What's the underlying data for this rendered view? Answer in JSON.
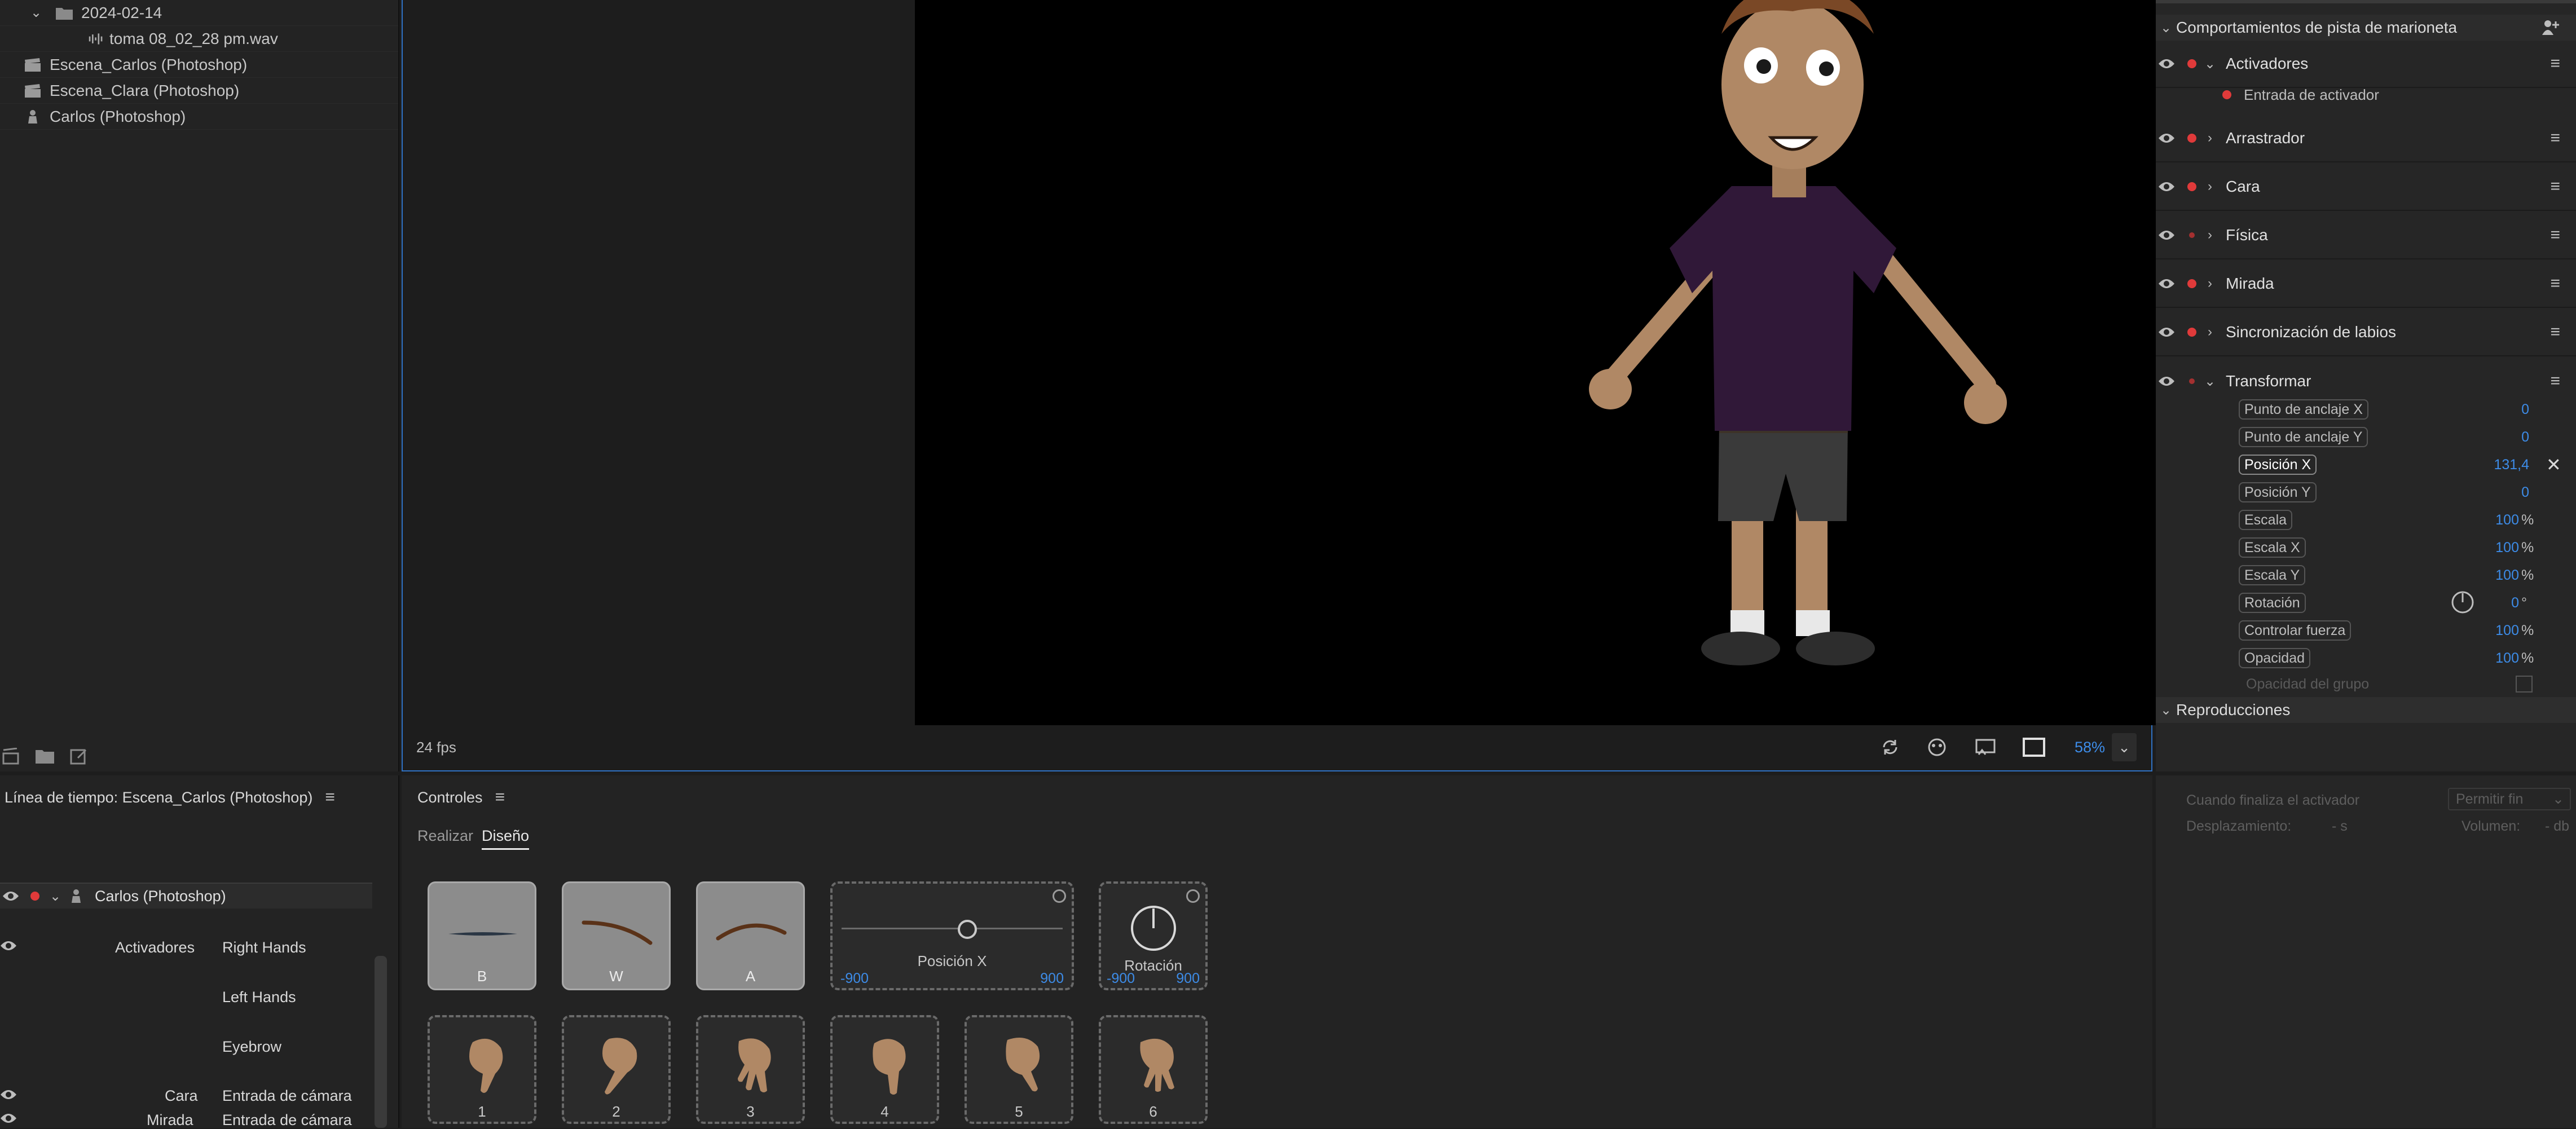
{
  "project": {
    "items": [
      {
        "label": "2024-02-14",
        "icon": "folder-icon"
      },
      {
        "label": "toma 08_02_28 pm.wav",
        "icon": "audio-icon"
      },
      {
        "label": "Escena_Carlos (Photoshop)",
        "icon": "clapboard-icon"
      },
      {
        "label": "Escena_Clara (Photoshop)",
        "icon": "clapboard-icon"
      },
      {
        "label": "Carlos (Photoshop)",
        "icon": "puppet-icon"
      }
    ]
  },
  "stage": {
    "fps": "24 fps",
    "zoom": "58%"
  },
  "properties": {
    "header": "Comportamientos de pista de marioneta",
    "behaviors": [
      {
        "name": "Activadores",
        "expanded": true
      },
      {
        "name": "Arrastrador",
        "expanded": false
      },
      {
        "name": "Cara",
        "expanded": false
      },
      {
        "name": "Física",
        "expanded": false
      },
      {
        "name": "Mirada",
        "expanded": false
      },
      {
        "name": "Sincronización de labios",
        "expanded": false
      },
      {
        "name": "Transformar",
        "expanded": true
      }
    ],
    "trigger_input": "Entrada de activador",
    "params": [
      {
        "label": "Punto de anclaje X",
        "value": "0",
        "unit": ""
      },
      {
        "label": "Punto de anclaje Y",
        "value": "0",
        "unit": ""
      },
      {
        "label": "Posición X",
        "value": "131,4",
        "unit": ""
      },
      {
        "label": "Posición Y",
        "value": "0",
        "unit": ""
      },
      {
        "label": "Escala",
        "value": "100",
        "unit": "%"
      },
      {
        "label": "Escala X",
        "value": "100",
        "unit": "%"
      },
      {
        "label": "Escala Y",
        "value": "100",
        "unit": "%"
      },
      {
        "label": "Rotación",
        "value": "0",
        "unit": "°"
      },
      {
        "label": "Controlar fuerza",
        "value": "100",
        "unit": "%"
      },
      {
        "label": "Opacidad",
        "value": "100",
        "unit": "%"
      }
    ],
    "group_opacity": "Opacidad del grupo",
    "replays": "Reproducciones",
    "trigger_end_label": "Cuando finaliza el activador",
    "trigger_end_value": "Permitir fin",
    "offset_label": "Desplazamiento:",
    "offset_value": "- s",
    "volume_label": "Volumen:",
    "volume_value": "- db"
  },
  "timeline": {
    "title": "Línea de tiempo: Escena_Carlos (Photoshop)",
    "puppet": "Carlos (Photoshop)",
    "rows": [
      {
        "group": "Activadores",
        "value": "Right Hands"
      },
      {
        "group": "",
        "value": "Left Hands"
      },
      {
        "group": "",
        "value": "Eyebrow"
      },
      {
        "group": "Cara",
        "value": "Entrada de cámara"
      },
      {
        "group": "Mirada",
        "value": "Entrada de cámara"
      }
    ]
  },
  "controls": {
    "title": "Controles",
    "tabs": [
      "Realizar",
      "Diseño"
    ],
    "active_tab": "Diseño",
    "tiles": [
      {
        "label": "B"
      },
      {
        "label": "W"
      },
      {
        "label": "A"
      }
    ],
    "slider": {
      "label": "Posición X",
      "min": "-900",
      "max": "900"
    },
    "knob": {
      "label": "Rotación",
      "min": "-900",
      "max": "900"
    },
    "hands": [
      "1",
      "2",
      "3",
      "4",
      "5",
      "6"
    ]
  },
  "colors": {
    "accent": "#2f72c4",
    "value_blue": "#3d8ce8",
    "record_red": "#e03a3a",
    "shirt": "#301838",
    "skin": "#b08865"
  }
}
